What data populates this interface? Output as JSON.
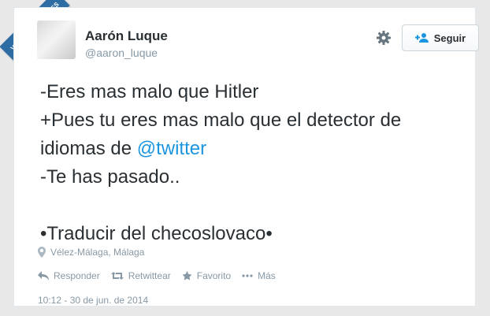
{
  "watermark": {
    "text": "VISTOENLASREDES"
  },
  "profile": {
    "name": "Aarón Luque",
    "handle": "@aaron_luque"
  },
  "header": {
    "settings_icon": "gear-icon",
    "follow_label": "Seguir",
    "follow_icon": "add-user-icon"
  },
  "tweet": {
    "line1": "-Eres mas malo que Hitler",
    "line2": "+Pues tu eres mas malo que el detector de",
    "line3_prefix": "idiomas de ",
    "line3_mention": "@twitter",
    "line4": "-Te has pasado..",
    "line6": "•Traducir del checoslovaco•"
  },
  "location": {
    "icon": "map-pin-icon",
    "text": "Vélez-Málaga, Málaga"
  },
  "actions": {
    "reply": "Responder",
    "retweet": "Retwittear",
    "favorite": "Favorito",
    "more": "Más"
  },
  "timestamp": "10:12 - 30 de jun. de 2014",
  "colors": {
    "link": "#1b95e0",
    "muted": "#8899a6",
    "text": "#292f33",
    "watermark_bg": "#2e6da4"
  }
}
